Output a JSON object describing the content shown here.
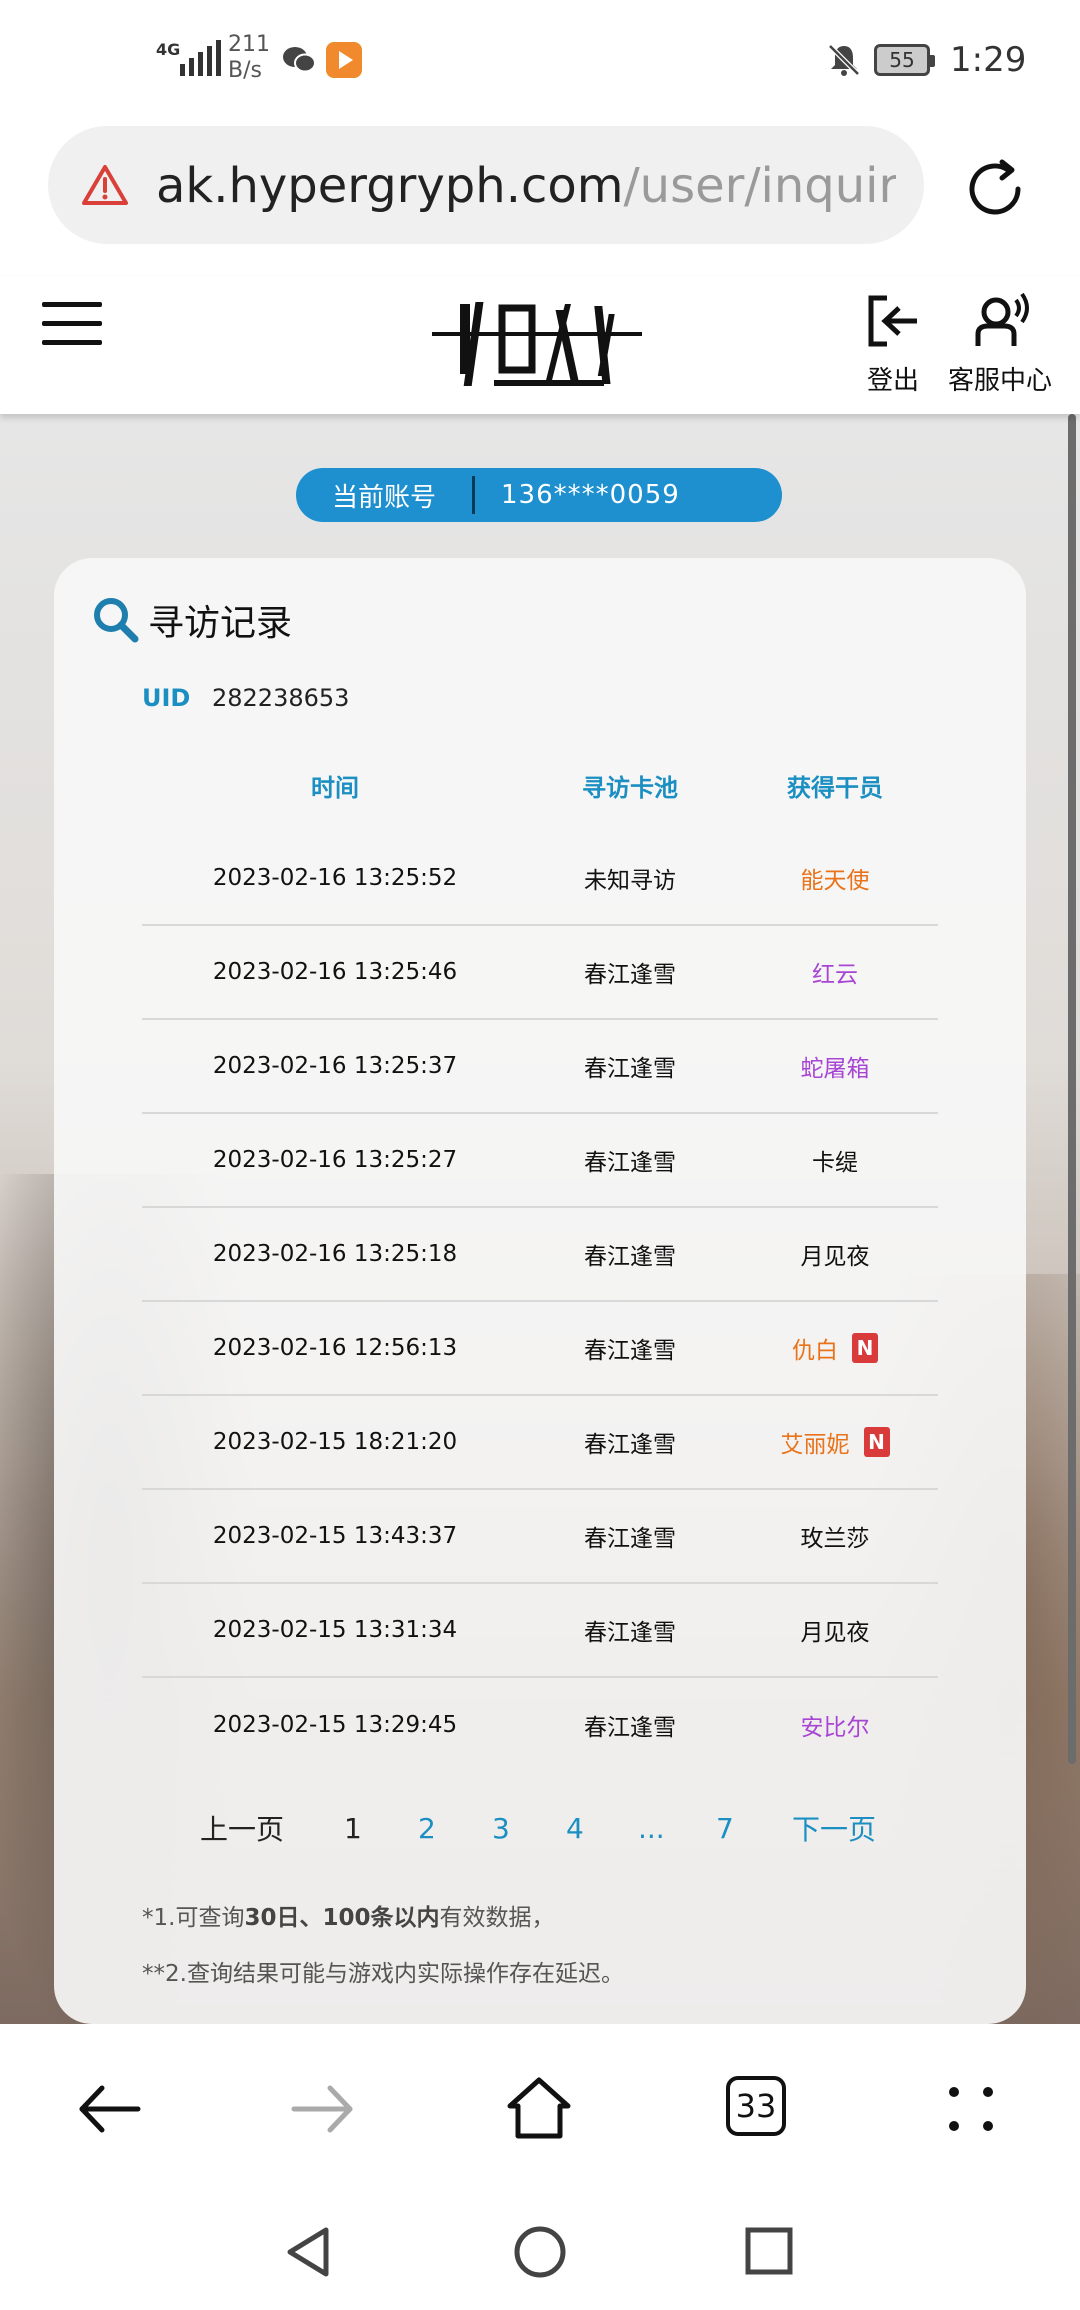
{
  "status_bar": {
    "network": "4G",
    "speed_value": "211",
    "speed_unit": "B/s",
    "battery": "55",
    "time": "1:29"
  },
  "address_bar": {
    "domain": "ak.hypergryph.com",
    "path": "/user/inquiryGa"
  },
  "header": {
    "logout_label": "登出",
    "customer_service_label": "客服中心"
  },
  "account": {
    "label": "当前账号",
    "value": "136****0059"
  },
  "card": {
    "title": "寻访记录",
    "uid_label": "UID",
    "uid_value": "282238653",
    "columns": [
      "时间",
      "寻访卡池",
      "获得干员"
    ],
    "rows": [
      {
        "time": "2023-02-16 13:25:52",
        "pool": "未知寻访",
        "operator": "能天使",
        "color": "orange",
        "new": false
      },
      {
        "time": "2023-02-16 13:25:46",
        "pool": "春江逢雪",
        "operator": "红云",
        "color": "purple",
        "new": false
      },
      {
        "time": "2023-02-16 13:25:37",
        "pool": "春江逢雪",
        "operator": "蛇屠箱",
        "color": "purple",
        "new": false
      },
      {
        "time": "2023-02-16 13:25:27",
        "pool": "春江逢雪",
        "operator": "卡缇",
        "color": "black",
        "new": false
      },
      {
        "time": "2023-02-16 13:25:18",
        "pool": "春江逢雪",
        "operator": "月见夜",
        "color": "black",
        "new": false
      },
      {
        "time": "2023-02-16 12:56:13",
        "pool": "春江逢雪",
        "operator": "仇白",
        "color": "orange",
        "new": true
      },
      {
        "time": "2023-02-15 18:21:20",
        "pool": "春江逢雪",
        "operator": "艾丽妮",
        "color": "orange",
        "new": true
      },
      {
        "time": "2023-02-15 13:43:37",
        "pool": "春江逢雪",
        "operator": "玫兰莎",
        "color": "black",
        "new": false
      },
      {
        "time": "2023-02-15 13:31:34",
        "pool": "春江逢雪",
        "operator": "月见夜",
        "color": "black",
        "new": false
      },
      {
        "time": "2023-02-15 13:29:45",
        "pool": "春江逢雪",
        "operator": "安比尔",
        "color": "purple",
        "new": false
      }
    ],
    "new_badge": "N",
    "pagination": {
      "prev": "上一页",
      "pages": [
        "1",
        "2",
        "3",
        "4",
        "...",
        "7"
      ],
      "current": "1",
      "next": "下一页"
    },
    "note1_prefix": "*1.可查询",
    "note1_bold1": "30日",
    "note1_mid": "、",
    "note1_bold2": "100条以内",
    "note1_suffix": "有效数据，",
    "note2": "**2.查询结果可能与游戏内实际操作存在延迟。"
  },
  "browser_bar": {
    "tab_count": "33"
  },
  "colors": {
    "accent": "#1e8fcf",
    "link": "#1b8fc2",
    "rarity_6": "#e9731a",
    "rarity_4": "#a846d4",
    "new_badge": "#d93a3a"
  },
  "icons": [
    "signal-icon",
    "wechat-icon",
    "app-notification-icon",
    "bell-muted-icon",
    "battery-icon",
    "warning-icon",
    "reload-icon",
    "menu-icon",
    "logout-icon",
    "headset-icon",
    "search-icon",
    "back-icon",
    "forward-icon",
    "home-icon",
    "more-icon"
  ]
}
